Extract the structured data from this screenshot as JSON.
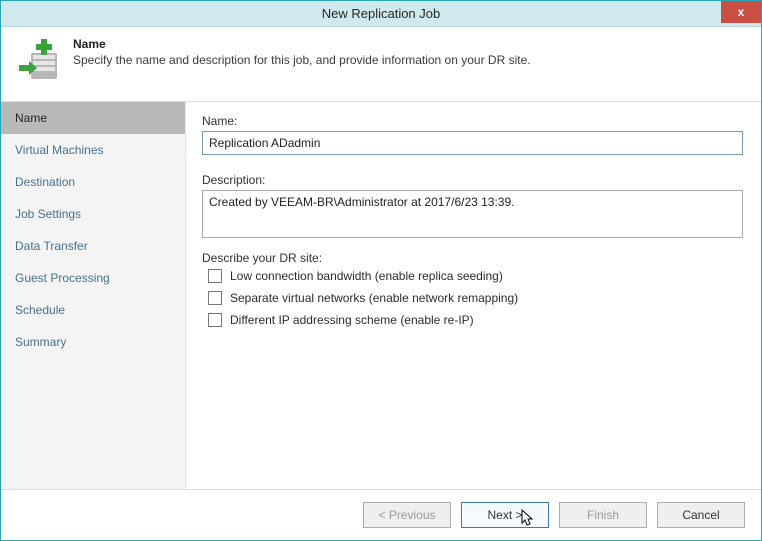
{
  "window": {
    "title": "New Replication Job",
    "close_symbol": "x"
  },
  "header": {
    "title": "Name",
    "subtitle": "Specify the name and description for this job, and provide information on your DR site."
  },
  "sidebar": {
    "steps": [
      {
        "label": "Name",
        "active": true
      },
      {
        "label": "Virtual Machines",
        "active": false
      },
      {
        "label": "Destination",
        "active": false
      },
      {
        "label": "Job Settings",
        "active": false
      },
      {
        "label": "Data Transfer",
        "active": false
      },
      {
        "label": "Guest Processing",
        "active": false
      },
      {
        "label": "Schedule",
        "active": false
      },
      {
        "label": "Summary",
        "active": false
      }
    ]
  },
  "form": {
    "name_label": "Name:",
    "name_value": "Replication ADadmin",
    "description_label": "Description:",
    "description_value": "Created by VEEAM-BR\\Administrator at 2017/6/23 13:39.",
    "dr_label": "Describe your DR site:",
    "options": [
      {
        "label": "Low connection bandwidth (enable replica seeding)",
        "checked": false
      },
      {
        "label": "Separate virtual networks (enable network remapping)",
        "checked": false
      },
      {
        "label": "Different IP addressing scheme (enable re-IP)",
        "checked": false
      }
    ]
  },
  "footer": {
    "previous": "< Previous",
    "next": "Next >",
    "finish": "Finish",
    "cancel": "Cancel"
  }
}
